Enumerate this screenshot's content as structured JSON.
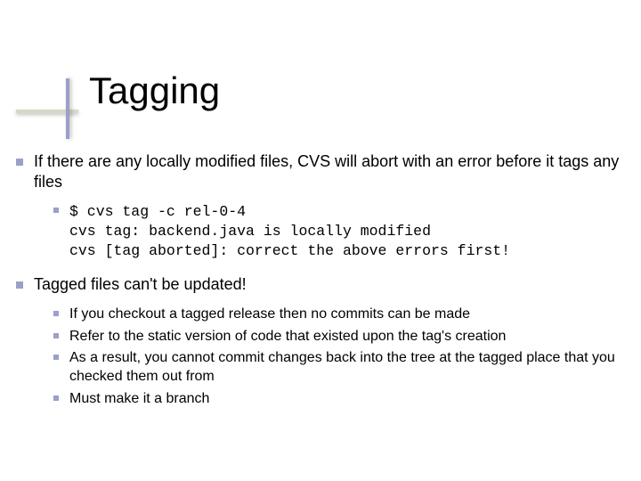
{
  "title": "Tagging",
  "bullets": [
    {
      "text": "If there are any locally modified files, CVS will abort with an error before it tags any files",
      "children": [
        {
          "mono": true,
          "text": "$ cvs tag -c rel-0-4\ncvs tag: backend.java is locally modified\ncvs [tag aborted]: correct the above errors first!"
        }
      ]
    },
    {
      "text": "Tagged files can't be updated!",
      "children": [
        {
          "text": "If you checkout a tagged release then no commits can be made"
        },
        {
          "text": "Refer to the static version of code that existed upon the tag's creation"
        },
        {
          "text": "As a result, you cannot commit changes back into the tree at the tagged place that you checked them out from"
        },
        {
          "text": "Must make it a branch"
        }
      ]
    }
  ]
}
